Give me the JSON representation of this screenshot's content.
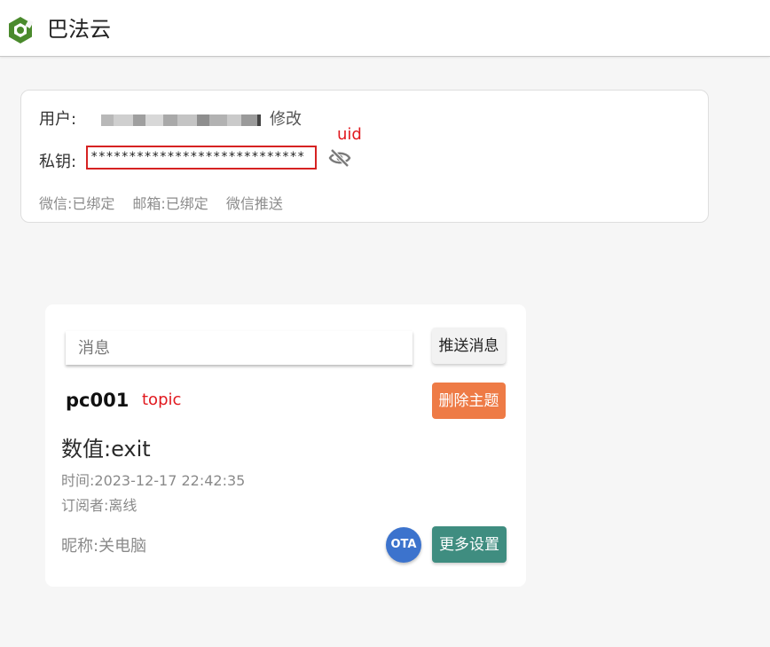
{
  "header": {
    "brand": "巴法云"
  },
  "account": {
    "user_label": "用户:",
    "edit_link": "修改",
    "key_label": "私钥:",
    "key_value": "****************************",
    "annotation_uid": "uid",
    "wechat_status": "微信:已绑定",
    "email_status": "邮箱:已绑定",
    "wechat_push": "微信推送"
  },
  "device": {
    "message_placeholder": "消息",
    "push_button": "推送消息",
    "topic_name": "pc001",
    "annotation_topic": "topic",
    "delete_button": "删除主题",
    "value_text": "数值:exit",
    "time_text": "时间:2023-12-17 22:42:35",
    "subscriber_text": "订阅者:离线",
    "nickname_text": "昵称:关电脑",
    "ota_button": "OTA",
    "more_button": "更多设置"
  },
  "colors": {
    "brand_green": "#4a8a2c",
    "delete_orange": "#ee7b46",
    "more_teal": "#3f8d80",
    "ota_blue": "#3c73cd",
    "annotation_red": "#e1181e"
  },
  "icons": {
    "logo": "bemfa-logo-icon",
    "eye": "eye-slash-icon"
  }
}
